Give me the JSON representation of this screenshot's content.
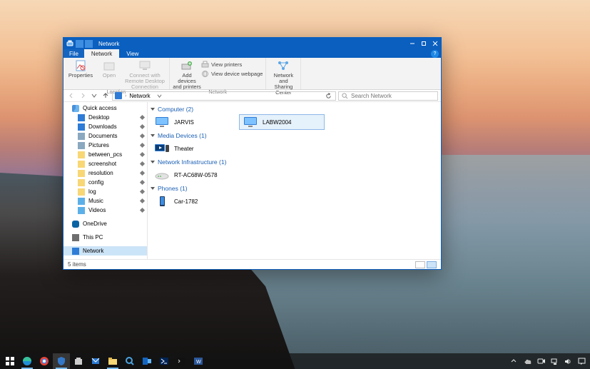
{
  "window": {
    "title": "Network",
    "tabs": {
      "file": "File",
      "network": "Network",
      "view": "View"
    },
    "win_controls": {
      "min": "Minimize",
      "max": "Maximize",
      "close": "Close"
    }
  },
  "ribbon": {
    "groups": {
      "location": {
        "label": "Location",
        "properties": "Properties",
        "open": "Open",
        "rdp": "Connect with Remote Desktop Connection"
      },
      "network": {
        "label": "Network",
        "add_devices": "Add devices and printers",
        "view_printers": "View printers",
        "view_webpage": "View device webpage"
      },
      "sharing": {
        "label": "",
        "center": "Network and Sharing Center"
      }
    }
  },
  "address": {
    "crumb": "Network",
    "refresh": "Refresh",
    "history": "Recent locations"
  },
  "search": {
    "placeholder": "Search Network"
  },
  "navpane": {
    "quick_access": "Quick access",
    "desktop": "Desktop",
    "downloads": "Downloads",
    "documents": "Documents",
    "pictures": "Pictures",
    "between_pcs": "between_pcs",
    "screenshot": "screenshot",
    "resolution": "resolution",
    "config": "config",
    "log": "log",
    "music": "Music",
    "videos": "Videos",
    "onedrive": "OneDrive",
    "this_pc": "This PC",
    "network": "Network"
  },
  "groups": {
    "computer": {
      "label": "Computer",
      "count": 2,
      "items": [
        "JARVIS",
        "LABW2004"
      ]
    },
    "media": {
      "label": "Media Devices",
      "count": 1,
      "items": [
        "Theater"
      ]
    },
    "infra": {
      "label": "Network Infrastructure",
      "count": 1,
      "items": [
        "RT-AC68W-0578"
      ]
    },
    "phones": {
      "label": "Phones",
      "count": 1,
      "items": [
        "Car-1782"
      ]
    }
  },
  "status": {
    "text": "5 items"
  },
  "taskbar": {
    "start": "Start",
    "apps": [
      "edge",
      "chrome",
      "defender",
      "store",
      "mail",
      "explorer",
      "find",
      "outlook",
      "powershell",
      "terminal",
      "word"
    ],
    "tray": {
      "onedrive": "OneDrive",
      "net": "Network",
      "vol": "Volume",
      "action": "Action Center"
    }
  },
  "colors": {
    "accent": "#0a5fbf",
    "select": "#cce4f7"
  }
}
